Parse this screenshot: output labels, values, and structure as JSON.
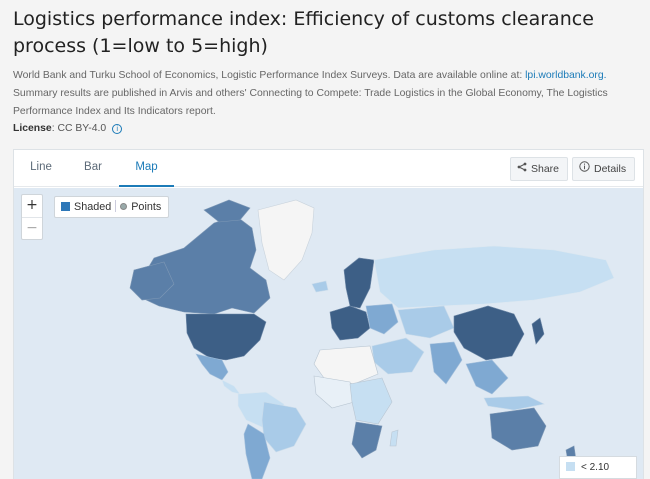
{
  "title": "Logistics performance index: Efficiency of customs clearance process (1=low to 5=high)",
  "source": {
    "text": "World Bank and Turku School of Economics, Logistic Performance Index Surveys. Data are available online at:",
    "link": "lpi.worldbank.org.",
    "text2": "Summary results are published in Arvis and others' Connecting to Compete: Trade Logistics in the Global Economy, The Logistics Performance Index and Its Indicators report."
  },
  "license": {
    "label": "License",
    "value": ": CC BY-4.0",
    "info_icon": "i"
  },
  "tabs": [
    {
      "label": "Line",
      "active": false
    },
    {
      "label": "Bar",
      "active": false
    },
    {
      "label": "Map",
      "active": true
    }
  ],
  "buttons": {
    "share": "Share",
    "details": "Details",
    "share_icon": "share-icon",
    "details_icon": "info-icon"
  },
  "zoom": {
    "in": "+",
    "out": "−"
  },
  "map_mode": {
    "shaded": "Shaded",
    "points": "Points",
    "selected": "Shaded"
  },
  "legend": {
    "first_bin": "< 2.10"
  },
  "colors": {
    "ocean": "#dfe9f3",
    "no_data": "#f5f5f5",
    "lowest": "#c6dff2",
    "low": "#a9cbe8",
    "mid": "#7fa9d2",
    "high": "#5b7fa8",
    "highest": "#3d5f86",
    "accent": "#1c7bb8"
  }
}
